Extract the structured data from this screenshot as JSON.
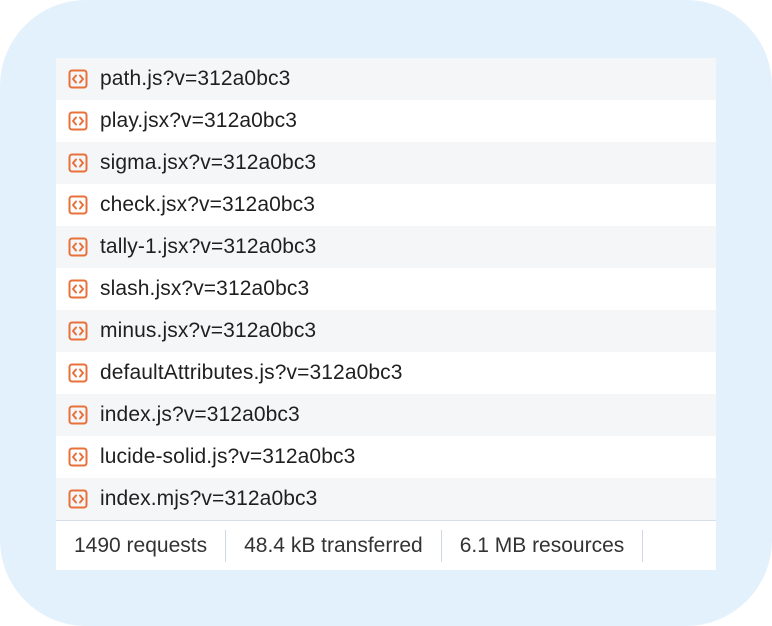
{
  "requests": [
    {
      "name": "path.js?v=312a0bc3",
      "icon": "script-file-icon"
    },
    {
      "name": "play.jsx?v=312a0bc3",
      "icon": "script-file-icon"
    },
    {
      "name": "sigma.jsx?v=312a0bc3",
      "icon": "script-file-icon"
    },
    {
      "name": "check.jsx?v=312a0bc3",
      "icon": "script-file-icon"
    },
    {
      "name": "tally-1.jsx?v=312a0bc3",
      "icon": "script-file-icon"
    },
    {
      "name": "slash.jsx?v=312a0bc3",
      "icon": "script-file-icon"
    },
    {
      "name": "minus.jsx?v=312a0bc3",
      "icon": "script-file-icon"
    },
    {
      "name": "defaultAttributes.js?v=312a0bc3",
      "icon": "script-file-icon"
    },
    {
      "name": "index.js?v=312a0bc3",
      "icon": "script-file-icon"
    },
    {
      "name": "lucide-solid.js?v=312a0bc3",
      "icon": "script-file-icon"
    },
    {
      "name": "index.mjs?v=312a0bc3",
      "icon": "script-file-icon"
    }
  ],
  "summary": {
    "requests": "1490 requests",
    "transferred": "48.4 kB transferred",
    "resources": "6.1 MB resources"
  },
  "colors": {
    "icon_accent": "#e8703a",
    "frame_background": "#e3f1fc",
    "row_alt": "#f5f6f8"
  }
}
